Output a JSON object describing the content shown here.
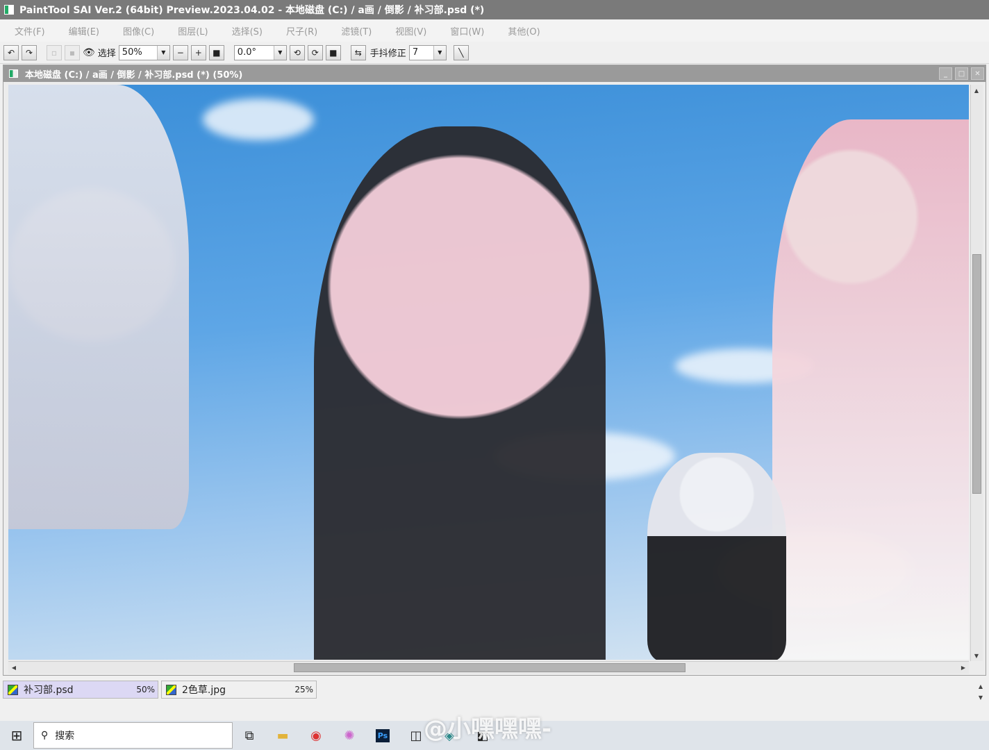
{
  "window": {
    "title": "PaintTool SAI Ver.2 (64bit) Preview.2023.04.02 - 本地磁盘 (C:) / a画 / 倒影 / 补习部.psd (*)"
  },
  "menu": [
    "文件(F)",
    "编辑(E)",
    "图像(C)",
    "图层(L)",
    "选择(S)",
    "尺子(R)",
    "滤镜(T)",
    "视图(V)",
    "窗口(W)",
    "其他(O)"
  ],
  "toolbar": {
    "select_label": "选择",
    "zoom_value": "50%",
    "rotation_value": "0.0°",
    "stabilizer_label": "手抖修正",
    "stabilizer_value": "7"
  },
  "document": {
    "title": "本地磁盘 (C:) / a画 / 倒影 / 补习部.psd (*) (50%)"
  },
  "file_tabs": [
    {
      "name": "补习部.psd",
      "zoom": "50%",
      "active": true
    },
    {
      "name": "2色草.jpg",
      "zoom": "25%",
      "active": false
    }
  ],
  "taskbar": {
    "search_placeholder": "搜索"
  },
  "watermark": "@小嘿嘿嘿-",
  "icons": [
    "app-icon",
    "undo-icon",
    "redo-icon",
    "eye-icon",
    "zoom-out-icon",
    "zoom-in-icon",
    "rotate-ccw-icon",
    "rotate-cw-icon",
    "flip-icon",
    "pen-icon",
    "windows-start-icon",
    "search-icon",
    "task-view-icon",
    "file-explorer-icon",
    "chrome-icon",
    "color-wheel-icon",
    "photoshop-icon"
  ]
}
